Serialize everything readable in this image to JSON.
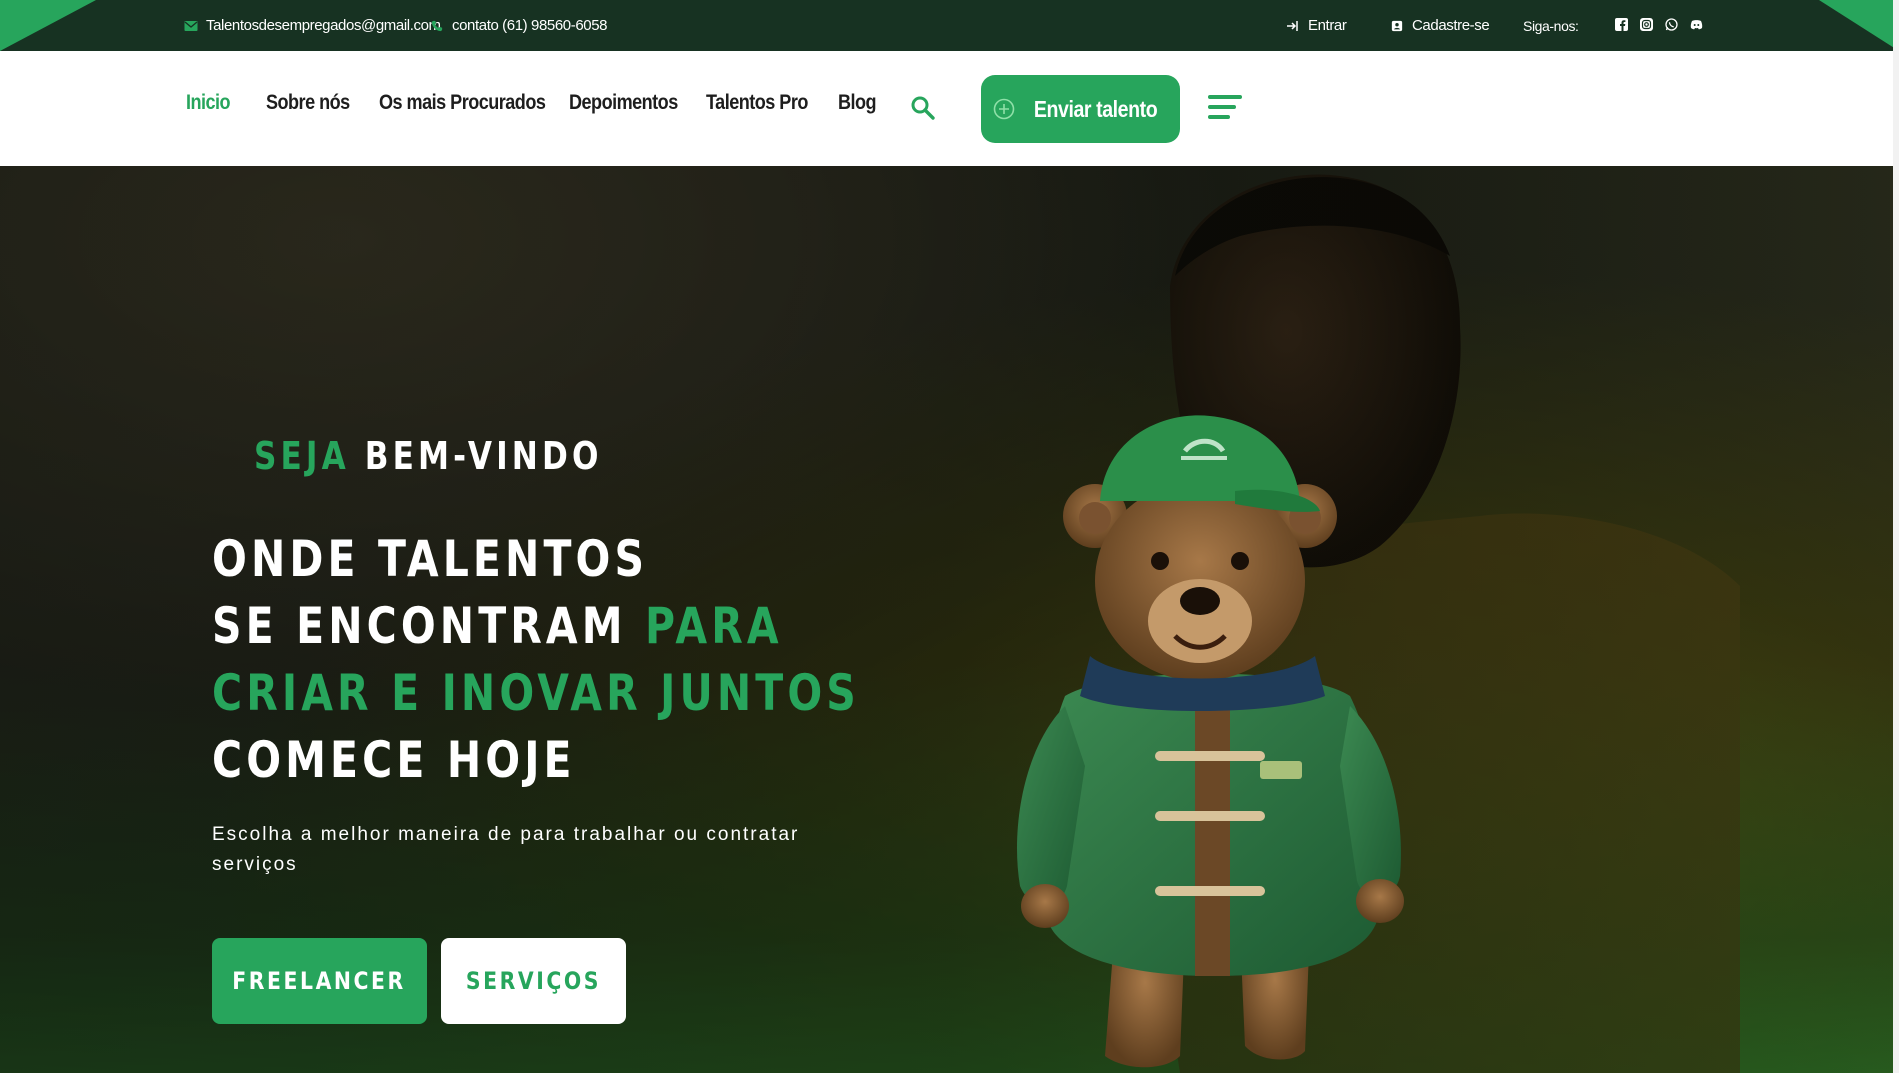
{
  "topbar": {
    "email": "Talentosdesempregados@gmail.com",
    "phone": "contato (61) 98560-6058",
    "login": "Entrar",
    "signup": "Cadastre-se",
    "follow": "Siga-nos:",
    "social_icons": [
      "facebook-icon",
      "instagram-icon",
      "whatsapp-icon",
      "discord-icon"
    ]
  },
  "nav": {
    "links": [
      "Inicio",
      "Sobre nós",
      "Os mais Procurados",
      "Depoimentos",
      "Talentos Pro",
      "Blog"
    ],
    "active_index": 0,
    "send_button": "Enviar talento"
  },
  "hero": {
    "welcome_green": "SEJA",
    "welcome_white": "BEM-VINDO",
    "line1": "ONDE TALENTOS",
    "line2_white": "SE ENCONTRAM",
    "line2_green": "PARA",
    "line3_green": "CRIAR E INOVAR JUNTOS",
    "line4": "COMECE HOJE",
    "subtitle": "Escolha a melhor maneira de para trabalhar ou contratar serviços",
    "btn_freelancer": "FREELANCER",
    "btn_servicos": "SERVIÇOS"
  },
  "colors": {
    "accent": "#27a55c",
    "topbar": "#173222",
    "white": "#ffffff",
    "nav_text": "#1e1e1e"
  }
}
